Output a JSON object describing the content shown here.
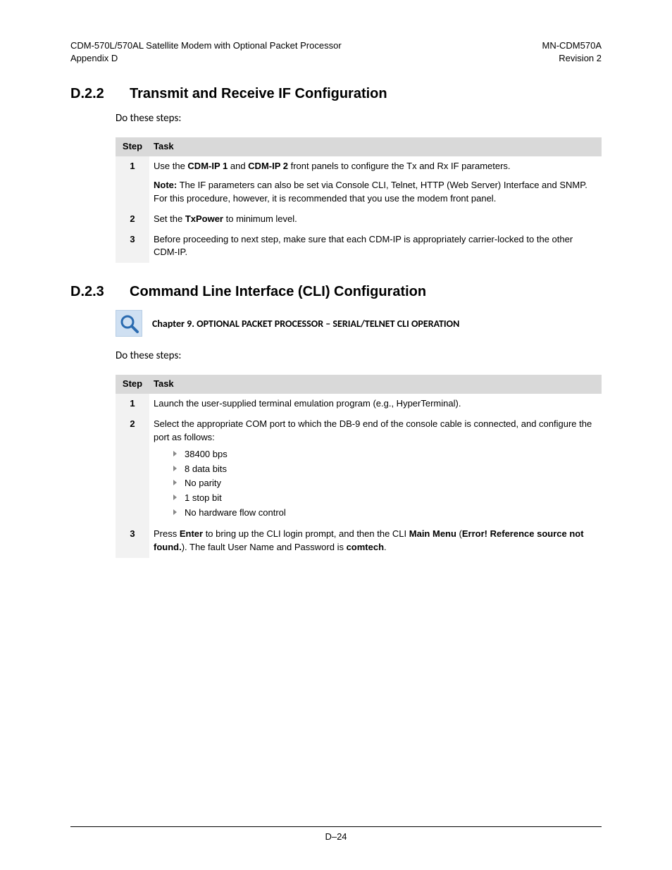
{
  "header": {
    "title_line1": "CDM-570L/570AL Satellite Modem with Optional Packet Processor",
    "title_line2": "Appendix D",
    "doc_id": "MN-CDM570A",
    "revision": "Revision 2"
  },
  "section1": {
    "number": "D.2.2",
    "title": "Transmit and Receive IF Configuration",
    "intro": "Do these steps:",
    "table": {
      "col_step": "Step",
      "col_task": "Task",
      "rows": [
        {
          "step": "1",
          "task_pre": "Use the ",
          "task_b1": "CDM-IP 1",
          "task_mid1": " and ",
          "task_b2": "CDM-IP 2",
          "task_post": " front panels to configure the Tx and Rx IF parameters.",
          "note_label": "Note:",
          "note_text": " The IF parameters can also be set via Console CLI, Telnet, HTTP (Web Server) Interface and SNMP. For this procedure, however, it is recommended that you use the modem front panel."
        },
        {
          "step": "2",
          "task_pre": "Set the ",
          "task_b1": "TxPower",
          "task_post": " to minimum level."
        },
        {
          "step": "3",
          "task_text": "Before proceeding to next step, make sure that each CDM-IP is appropriately carrier-locked to the other CDM-IP."
        }
      ]
    }
  },
  "section2": {
    "number": "D.2.3",
    "title": "Command Line Interface (CLI) Configuration",
    "callout": "Chapter 9. OPTIONAL PACKET PROCESSOR – SERIAL/TELNET CLI OPERATION",
    "intro": "Do these steps:",
    "table": {
      "col_step": "Step",
      "col_task": "Task",
      "rows": [
        {
          "step": "1",
          "task_text": "Launch the user-supplied terminal emulation program (e.g., HyperTerminal)."
        },
        {
          "step": "2",
          "task_text": "Select the appropriate COM port to which the DB-9 end of the console cable is connected, and configure the port as follows:",
          "bullets": [
            "38400 bps",
            "8 data bits",
            "No parity",
            "1 stop bit",
            "No hardware flow control"
          ]
        },
        {
          "step": "3",
          "task_pre": "Press ",
          "task_b1": "Enter",
          "task_mid1": " to bring up the CLI login prompt, and then the CLI ",
          "task_b2": "Main Menu",
          "task_mid2": " (",
          "task_b3": "Error! Reference source not found.",
          "task_mid3": "). The fault User Name and Password is ",
          "task_b4": "comtech",
          "task_post": "."
        }
      ]
    }
  },
  "footer": {
    "page": "D–24"
  }
}
